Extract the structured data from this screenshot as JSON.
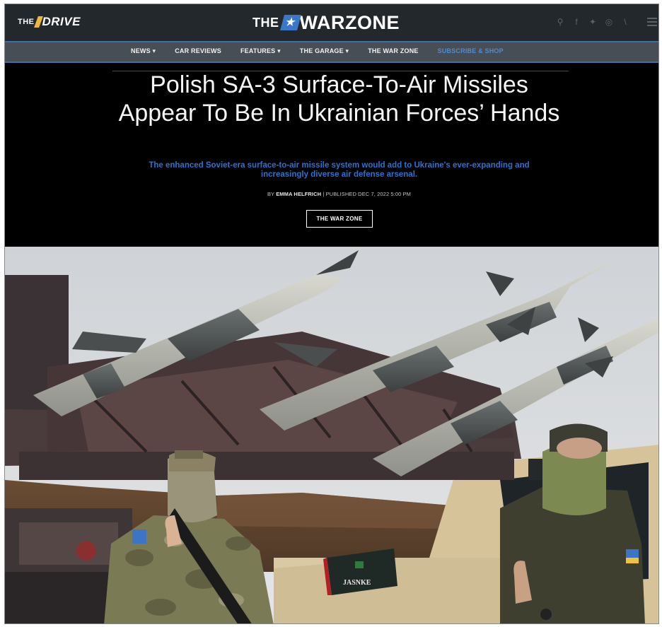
{
  "topbar": {
    "drive_logo_prefix": "THE",
    "drive_logo_text": "DRIVE",
    "warzone_logo_prefix": "THE",
    "warzone_logo_text": "WARZONE",
    "social_icons": [
      "search-icon",
      "facebook-icon",
      "twitter-icon",
      "instagram-icon",
      "rss-icon"
    ]
  },
  "nav": {
    "items": [
      {
        "label": "NEWS ▾"
      },
      {
        "label": "CAR REVIEWS"
      },
      {
        "label": "FEATURES ▾"
      },
      {
        "label": "THE GARAGE ▾"
      },
      {
        "label": "THE WAR ZONE"
      },
      {
        "label": "SUBSCRIBE & SHOP"
      }
    ]
  },
  "article": {
    "headline": "Polish SA-3 Surface-To-Air Missiles Appear To Be In Ukrainian Forces’ Hands",
    "subtitle": "The enhanced Soviet-era surface-to-air missile system would add to Ukraine's ever-expanding and increasingly diverse air defense arsenal.",
    "byline_prefix": "BY",
    "author": "EMMA HELFRICH",
    "separator": "|",
    "published": "PUBLISHED DEC 7, 2022 5:00 PM",
    "tag": "THE WAR ZONE"
  },
  "hero": {
    "box_label": "JASNKE"
  },
  "colors": {
    "topbar_bg": "#23282c",
    "navbar_bg": "#474e55",
    "accent_blue": "#2c73d1",
    "logo_gold": "#f0b73a"
  }
}
